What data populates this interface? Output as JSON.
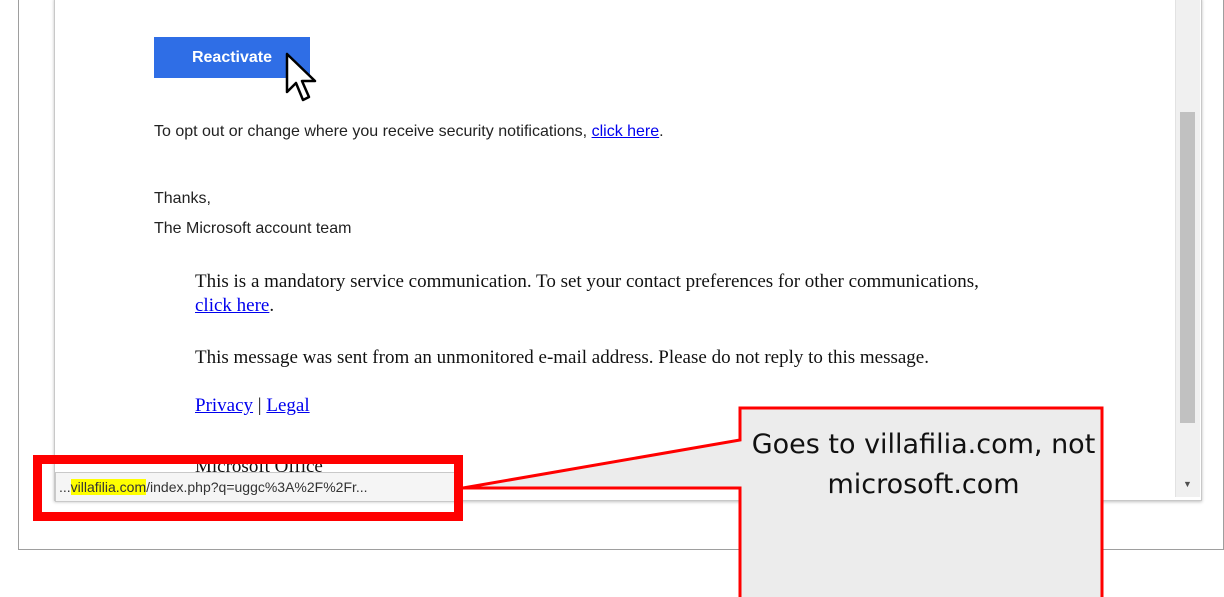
{
  "email": {
    "reactivate_button": "Reactivate",
    "opt_out_text": "To opt out or change where you receive security notifications,",
    "opt_out_link": "click here",
    "opt_out_end": ".",
    "thanks": "Thanks,",
    "team": "The Microsoft account team",
    "mandatory_text": "This is a mandatory service communication. To set your contact preferences for other communications,",
    "mandatory_link": "click here",
    "mandatory_end": ".",
    "unmonitored_text": "This message was sent from an unmonitored e-mail address. Please do not reply to this message.",
    "privacy_link": "Privacy",
    "separator": "|",
    "legal_link": "Legal",
    "cutoff_text": "Microsoft Office"
  },
  "status_bar": {
    "prefix": "...",
    "highlighted": "villafilia.com",
    "rest": "/index.php?q=uggc%3A%2F%2Fr..."
  },
  "callout": {
    "text": "Goes to villafilia.com, not microsoft.com"
  },
  "colors": {
    "button": "#2f6ee6",
    "link": "#0000ee",
    "annotation_red": "#ff0000",
    "highlight": "#ffff00",
    "callout_fill": "#ececec"
  }
}
